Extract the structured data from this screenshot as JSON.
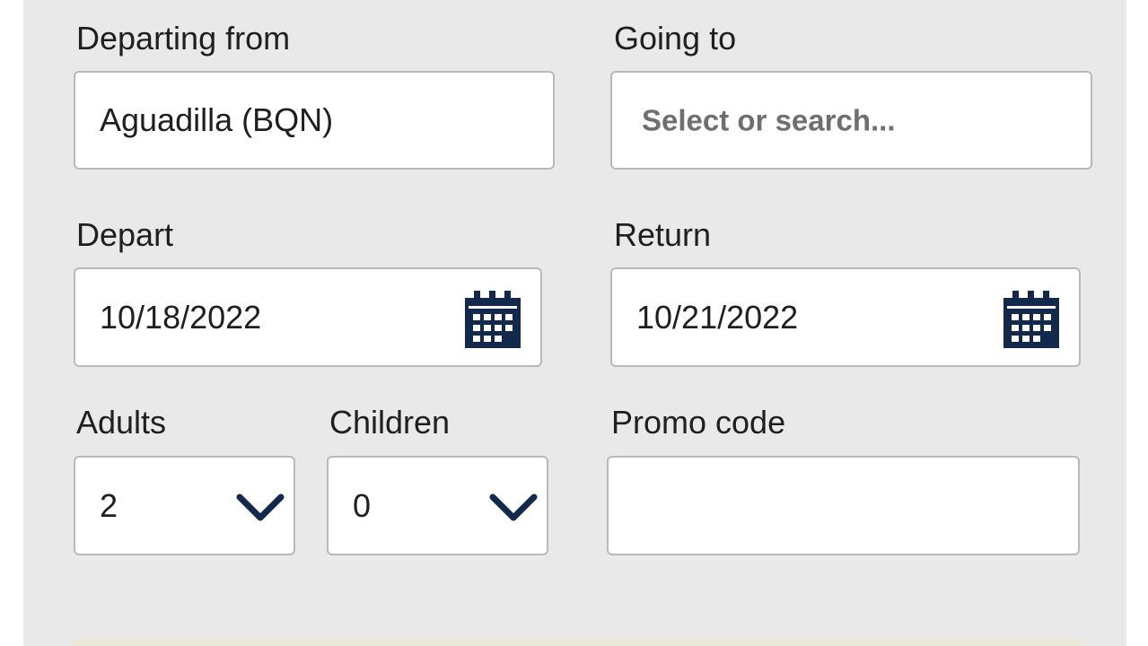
{
  "form": {
    "departing_from": {
      "label": "Departing from",
      "value": "Aguadilla (BQN)"
    },
    "going_to": {
      "label": "Going to",
      "placeholder": "Select or search..."
    },
    "depart": {
      "label": "Depart",
      "value": "10/18/2022",
      "icon": "calendar-icon"
    },
    "return": {
      "label": "Return",
      "value": "10/21/2022",
      "icon": "calendar-icon"
    },
    "adults": {
      "label": "Adults",
      "value": "2",
      "icon": "chevron-down-icon"
    },
    "children": {
      "label": "Children",
      "value": "0",
      "icon": "chevron-down-icon"
    },
    "promo_code": {
      "label": "Promo code",
      "value": ""
    }
  },
  "colors": {
    "panel_background": "#e9e9e9",
    "field_background": "#ffffff",
    "field_border": "#b9b9b9",
    "icon_navy": "#12294b",
    "text": "#1f1f1f",
    "placeholder": "#6f6f6f"
  }
}
